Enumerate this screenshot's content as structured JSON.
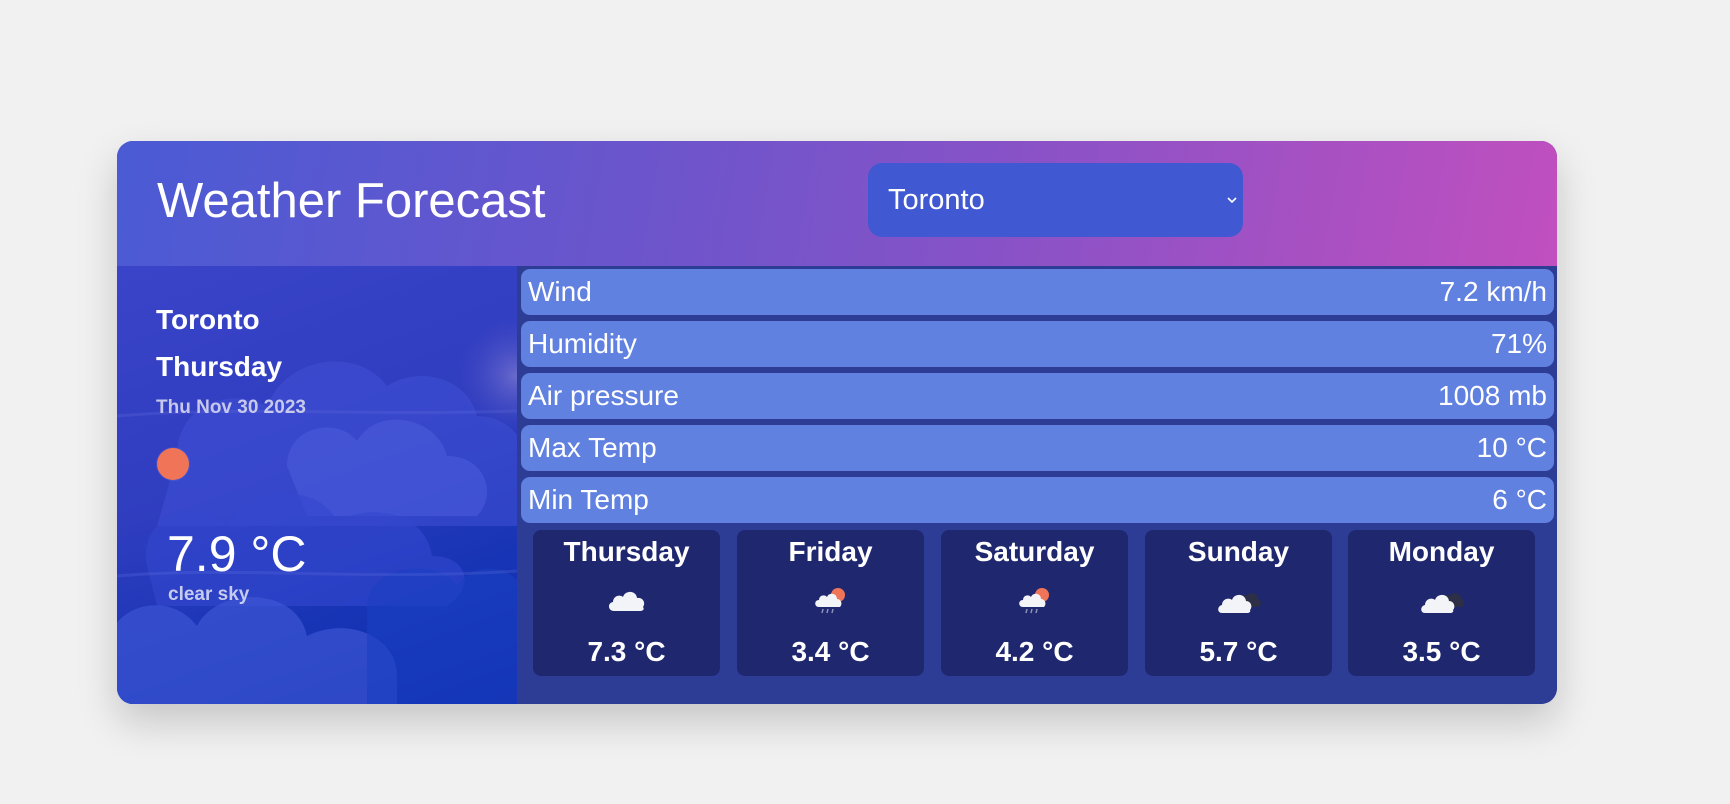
{
  "header": {
    "title": "Weather Forecast",
    "city_select": {
      "selected": "Toronto",
      "icon": "chevron-down-icon"
    }
  },
  "current": {
    "city": "Toronto",
    "day": "Thursday",
    "date": "Thu Nov 30 2023",
    "icon": "sun-icon",
    "temperature": "7.9 °C",
    "description": "clear sky"
  },
  "stats": [
    {
      "label": "Wind",
      "value": "7.2 km/h"
    },
    {
      "label": "Humidity",
      "value": "71%"
    },
    {
      "label": "Air pressure",
      "value": "1008 mb"
    },
    {
      "label": "Max Temp",
      "value": "10 °C"
    },
    {
      "label": "Min Temp",
      "value": "6 °C"
    }
  ],
  "forecast": [
    {
      "day": "Thursday",
      "icon": "cloud-icon",
      "temp": "7.3 °C"
    },
    {
      "day": "Friday",
      "icon": "sun-cloud-rain-icon",
      "temp": "3.4 °C"
    },
    {
      "day": "Saturday",
      "icon": "sun-cloud-rain-icon",
      "temp": "4.2 °C"
    },
    {
      "day": "Sunday",
      "icon": "broken-clouds-icon",
      "temp": "5.7 °C"
    },
    {
      "day": "Monday",
      "icon": "broken-clouds-icon",
      "temp": "3.5 °C"
    }
  ],
  "colors": {
    "page_background": "#f1f1f1",
    "header_gradient_start": "#4a5bd4",
    "header_gradient_end": "#c14fbf",
    "select_background": "#4058d2",
    "stat_row": "#6081e0",
    "forecast_card": "#1f276f",
    "panel": "#2d3c94",
    "sun": "#ef7458"
  }
}
